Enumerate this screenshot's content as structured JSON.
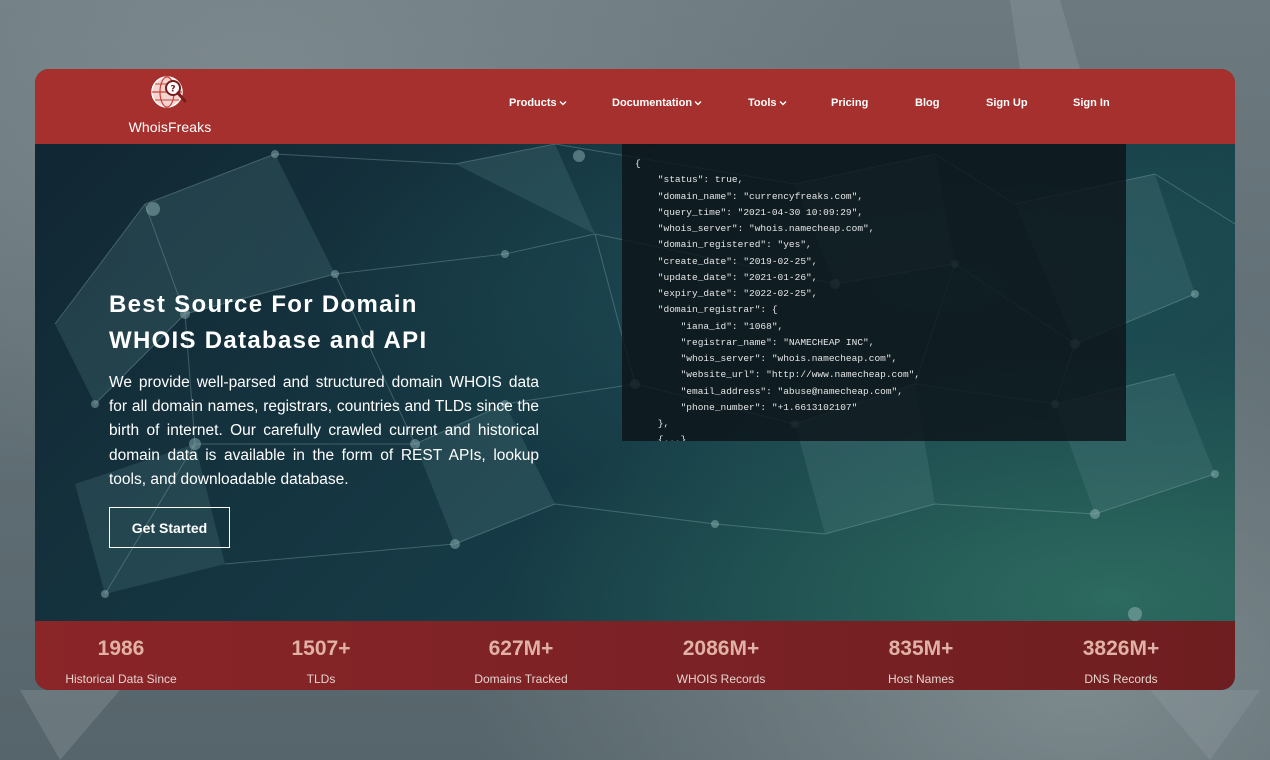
{
  "brand": {
    "name": "WhoisFreaks",
    "logo_icon": "globe-magnifier-icon"
  },
  "nav": {
    "items": [
      {
        "label": "Products",
        "has_dropdown": true
      },
      {
        "label": "Documentation",
        "has_dropdown": true
      },
      {
        "label": "Tools",
        "has_dropdown": true
      },
      {
        "label": "Pricing",
        "has_dropdown": false
      },
      {
        "label": "Blog",
        "has_dropdown": false
      },
      {
        "label": "Sign Up",
        "has_dropdown": false
      },
      {
        "label": "Sign In",
        "has_dropdown": false
      }
    ]
  },
  "hero": {
    "title_line1": "Best Source For Domain",
    "title_line2": "WHOIS Database and API",
    "description": "We provide well-parsed and structured domain WHOIS data for all domain names, registrars, countries and TLDs since the birth of internet. Our carefully crawled current and historical domain data is available in the form of REST APIs, lookup tools, and downloadable database.",
    "cta_label": "Get Started"
  },
  "code_sample": {
    "lines": [
      "{",
      "    \"status\": true,",
      "    \"domain_name\": \"currencyfreaks.com\",",
      "    \"query_time\": \"2021-04-30 10:09:29\",",
      "    \"whois_server\": \"whois.namecheap.com\",",
      "    \"domain_registered\": \"yes\",",
      "    \"create_date\": \"2019-02-25\",",
      "    \"update_date\": \"2021-01-26\",",
      "    \"expiry_date\": \"2022-02-25\",",
      "    \"domain_registrar\": {",
      "        \"iana_id\": \"1068\",",
      "        \"registrar_name\": \"NAMECHEAP INC\",",
      "        \"whois_server\": \"whois.namecheap.com\",",
      "        \"website_url\": \"http://www.namecheap.com\",",
      "        \"email_address\": \"abuse@namecheap.com\",",
      "        \"phone_number\": \"+1.6613102107\"",
      "    },",
      "    {...}"
    ]
  },
  "stats": [
    {
      "value": "1986",
      "label": "Historical Data Since"
    },
    {
      "value": "1507+",
      "label": "TLDs"
    },
    {
      "value": "627M+",
      "label": "Domains Tracked"
    },
    {
      "value": "2086M+",
      "label": "WHOIS Records"
    },
    {
      "value": "835M+",
      "label": "Host Names"
    },
    {
      "value": "3826M+",
      "label": "DNS Records"
    }
  ],
  "colors": {
    "header": "#a6302d",
    "stats_bar": "#7c2226",
    "stat_value": "#e0b1a4",
    "hero_bg": "#123038"
  }
}
